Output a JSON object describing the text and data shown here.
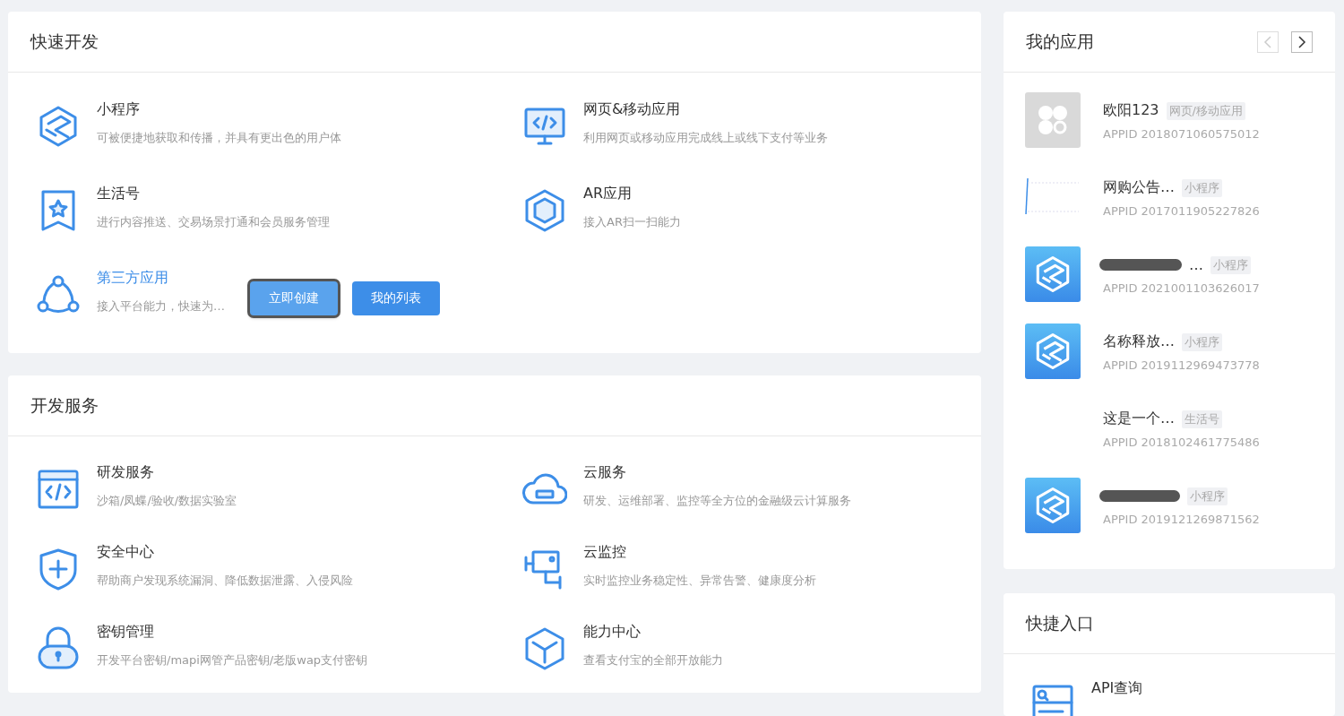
{
  "quick_dev": {
    "title": "快速开发",
    "items": [
      {
        "kind": "mini",
        "title": "小程序",
        "desc": "可被便捷地获取和传播，并具有更出色的用户体",
        "highlighted": false
      },
      {
        "kind": "monitor",
        "title": "网页&移动应用",
        "desc": "利用网页或移动应用完成线上或线下支付等业务",
        "highlighted": false
      },
      {
        "kind": "bookmark",
        "title": "生活号",
        "desc": "进行内容推送、交易场景打通和会员服务管理",
        "highlighted": false
      },
      {
        "kind": "ar",
        "title": "AR应用",
        "desc": "接入AR扫一扫能力",
        "highlighted": false
      },
      {
        "kind": "share",
        "title": "第三方应用",
        "desc": "接入平台能力，快速为…",
        "highlighted": true,
        "buttons": [
          {
            "label": "立即创建",
            "focused": true
          },
          {
            "label": "我的列表",
            "focused": false
          }
        ]
      }
    ]
  },
  "dev_services": {
    "title": "开发服务",
    "items": [
      {
        "kind": "code",
        "title": "研发服务",
        "desc": "沙箱/凤蝶/验收/数据实验室"
      },
      {
        "kind": "cloud",
        "title": "云服务",
        "desc": "研发、运维部署、监控等全方位的金融级云计算服务"
      },
      {
        "kind": "shield",
        "title": "安全中心",
        "desc": "帮助商户发现系统漏洞、降低数据泄露、入侵风险"
      },
      {
        "kind": "camera",
        "title": "云监控",
        "desc": "实时监控业务稳定性、异常告警、健康度分析"
      },
      {
        "kind": "lock",
        "title": "密钥管理",
        "desc": "开发平台密钥/mapi网管产品密钥/老版wap支付密钥"
      },
      {
        "kind": "cube",
        "title": "能力中心",
        "desc": "查看支付宝的全部开放能力"
      }
    ]
  },
  "my_apps": {
    "title": "我的应用",
    "prev_disabled": true,
    "next_disabled": false,
    "apps": [
      {
        "kind": "clover",
        "name": "欧阳123",
        "tag": "网页/移动应用",
        "appid": "APPID 2018071060575012",
        "redacted": false
      },
      {
        "kind": "broken",
        "name": "网购公告…",
        "tag": "小程序",
        "appid": "APPID 2017011905227826",
        "redacted": false
      },
      {
        "kind": "hex",
        "name": "…",
        "tag": "小程序",
        "appid": "APPID 2021001103626017",
        "redacted": true
      },
      {
        "kind": "hex",
        "name": "名称释放…",
        "tag": "小程序",
        "appid": "APPID 2019112969473778",
        "redacted": false
      },
      {
        "kind": "none",
        "name": "这是一个…",
        "tag": "生活号",
        "appid": "APPID 2018102461775486",
        "redacted": false
      },
      {
        "kind": "hex",
        "tag": "小程序",
        "appid": "APPID 2019121269871562",
        "redacted": true
      }
    ]
  },
  "shortcuts": {
    "title": "快捷入口",
    "items": [
      {
        "kind": "api",
        "title": "API查询"
      }
    ]
  }
}
